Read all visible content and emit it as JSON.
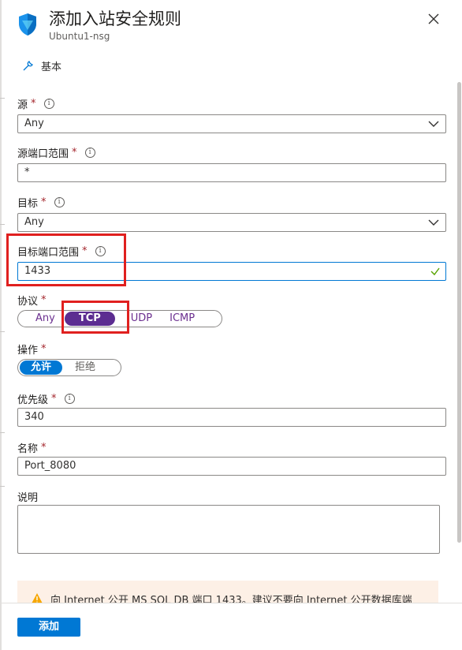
{
  "header": {
    "title": "添加入站安全规则",
    "subtitle": "Ubuntu1-nsg",
    "close_icon": "close-icon",
    "shield_icon": "shield-icon"
  },
  "section": {
    "icon": "wrench-icon",
    "label": "基本"
  },
  "fields": {
    "source": {
      "label": "源",
      "required": "*",
      "value": "Any"
    },
    "source_port": {
      "label": "源端口范围",
      "required": "*",
      "value": "*"
    },
    "destination": {
      "label": "目标",
      "required": "*",
      "value": "Any"
    },
    "dest_port": {
      "label": "目标端口范围",
      "required": "*",
      "value": "1433"
    },
    "protocol": {
      "label": "协议",
      "required": "*",
      "options": [
        "Any",
        "TCP",
        "UDP",
        "ICMP"
      ],
      "selected": "TCP"
    },
    "action": {
      "label": "操作",
      "required": "*",
      "options": [
        "允许",
        "拒绝"
      ],
      "selected": "允许"
    },
    "priority": {
      "label": "优先级",
      "required": "*",
      "value": "340"
    },
    "name": {
      "label": "名称",
      "required": "*",
      "value": "Port_8080"
    },
    "description": {
      "label": "说明",
      "value": ""
    }
  },
  "warning": {
    "icon": "warning-icon",
    "text": "向 Internet 公开 MS SQL DB 端口 1433。建议不要向 Internet 公开数据库端"
  },
  "footer": {
    "add_label": "添加"
  },
  "colors": {
    "accent": "#0078d4",
    "protocol_selected": "#5c2d91",
    "required": "#a4262c",
    "highlight": "#e0201f",
    "warning_bg": "#fdf0e6"
  }
}
